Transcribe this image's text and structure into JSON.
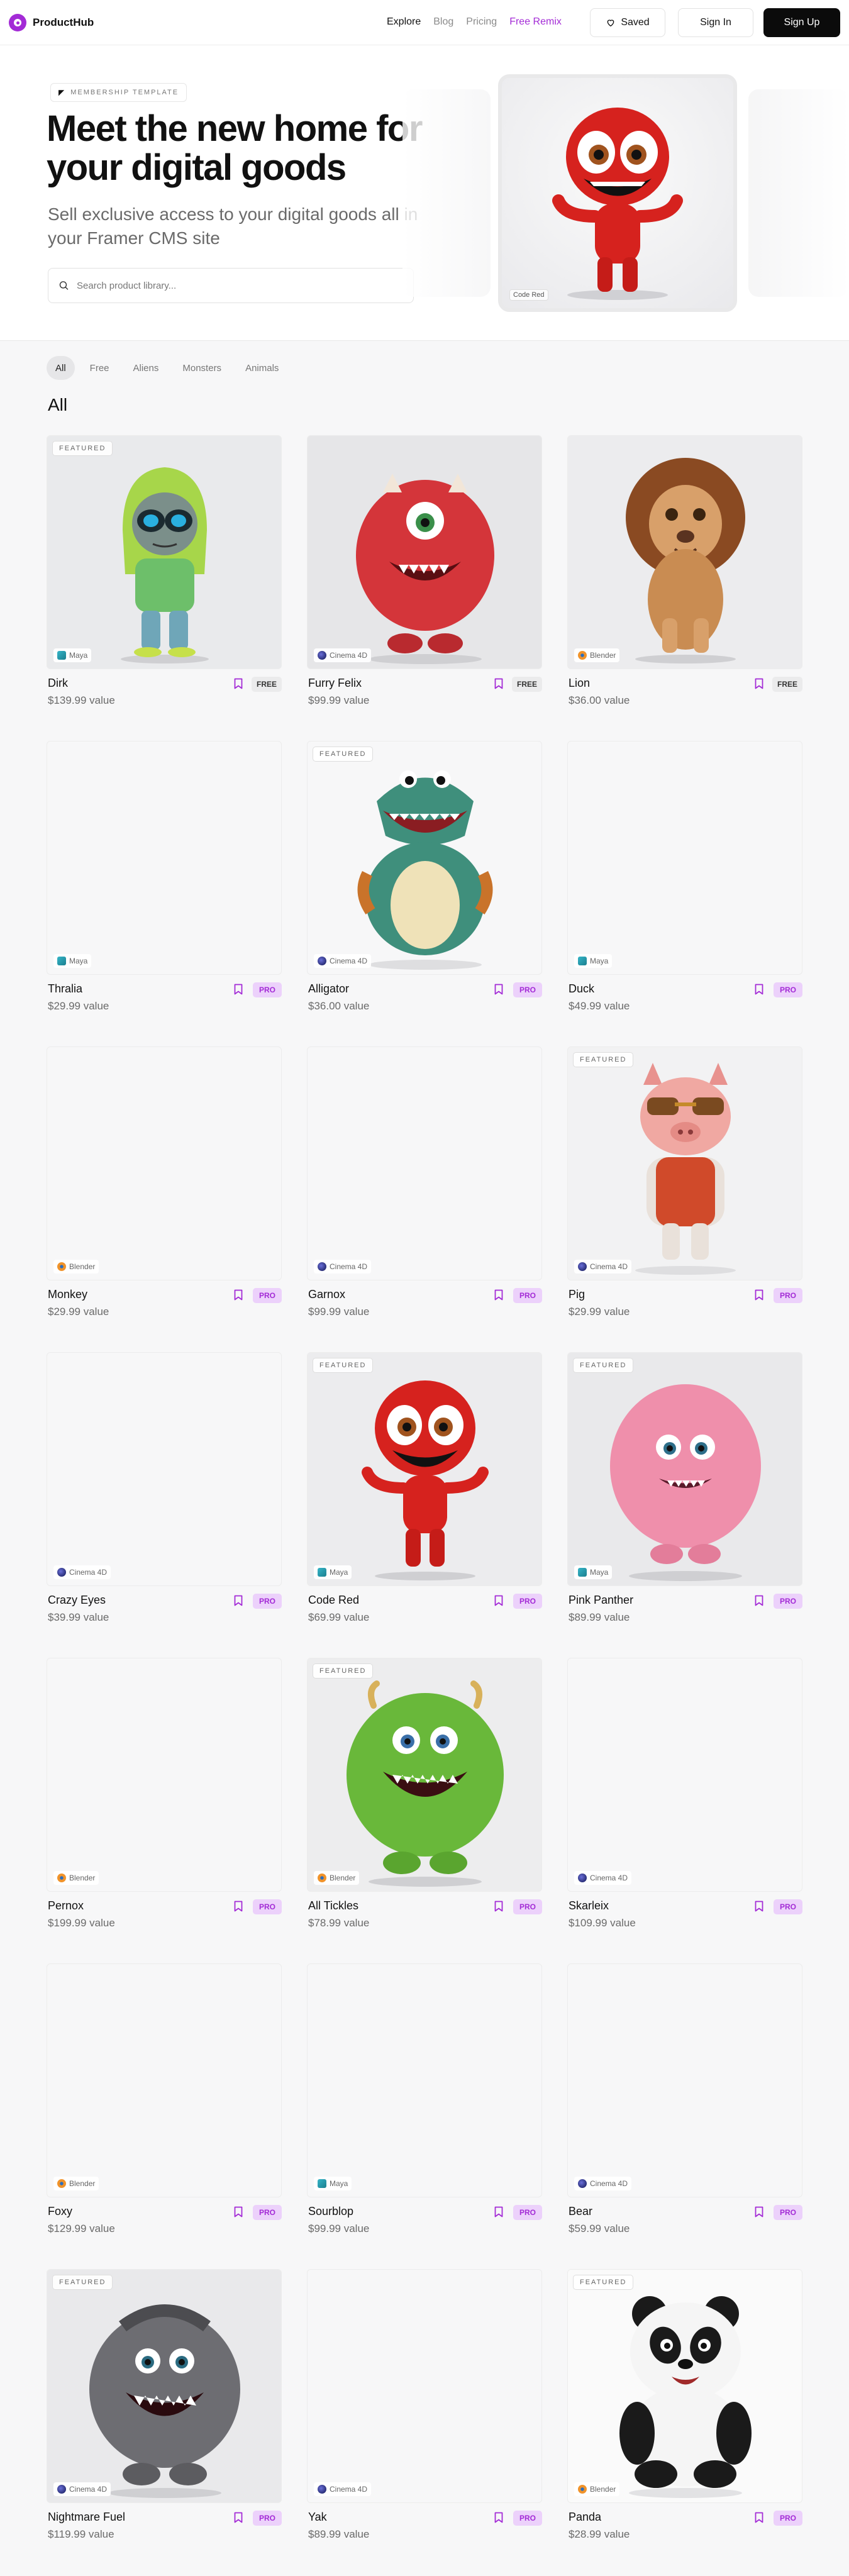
{
  "nav": {
    "brand": "ProductHub",
    "links": [
      "Explore",
      "Blog",
      "Pricing",
      "Free Remix"
    ],
    "saved_label": "Saved",
    "signin_label": "Sign In",
    "signup_label": "Sign Up"
  },
  "hero": {
    "tag": "MEMBERSHIP TEMPLATE",
    "title": "Meet the new home for your digital goods",
    "subtitle": "Sell exclusive access to your digital goods all in your Framer CMS site",
    "search_placeholder": "Search product library...",
    "card_label": "Code Red"
  },
  "filters": [
    "All",
    "Free",
    "Aliens",
    "Monsters",
    "Animals"
  ],
  "section_title": "All",
  "products": [
    {
      "name": "Dirk",
      "price": "$139.99 value",
      "tool": "Maya",
      "badge": "FREE",
      "featured": true,
      "image": "alien"
    },
    {
      "name": "Furry Felix",
      "price": "$99.99 value",
      "tool": "Cinema 4D",
      "badge": "FREE",
      "featured": false,
      "image": "red-monster"
    },
    {
      "name": "Lion",
      "price": "$36.00 value",
      "tool": "Blender",
      "badge": "FREE",
      "featured": false,
      "image": "lion"
    },
    {
      "name": "Thralia",
      "price": "$29.99 value",
      "tool": "Maya",
      "badge": "PRO",
      "featured": false,
      "image": "blank"
    },
    {
      "name": "Alligator",
      "price": "$36.00 value",
      "tool": "Cinema 4D",
      "badge": "PRO",
      "featured": true,
      "image": "alligator"
    },
    {
      "name": "Duck",
      "price": "$49.99 value",
      "tool": "Maya",
      "badge": "PRO",
      "featured": false,
      "image": "blank"
    },
    {
      "name": "Monkey",
      "price": "$29.99 value",
      "tool": "Blender",
      "badge": "PRO",
      "featured": false,
      "image": "blank"
    },
    {
      "name": "Garnox",
      "price": "$99.99 value",
      "tool": "Cinema 4D",
      "badge": "PRO",
      "featured": false,
      "image": "blank"
    },
    {
      "name": "Pig",
      "price": "$29.99 value",
      "tool": "Cinema 4D",
      "badge": "PRO",
      "featured": true,
      "image": "pig"
    },
    {
      "name": "Crazy Eyes",
      "price": "$39.99 value",
      "tool": "Cinema 4D",
      "badge": "PRO",
      "featured": false,
      "image": "blank"
    },
    {
      "name": "Code Red",
      "price": "$69.99 value",
      "tool": "Maya",
      "badge": "PRO",
      "featured": true,
      "image": "code-red"
    },
    {
      "name": "Pink Panther",
      "price": "$89.99 value",
      "tool": "Maya",
      "badge": "PRO",
      "featured": true,
      "image": "pink-monster"
    },
    {
      "name": "Pernox",
      "price": "$199.99 value",
      "tool": "Blender",
      "badge": "PRO",
      "featured": false,
      "image": "blank"
    },
    {
      "name": "All Tickles",
      "price": "$78.99 value",
      "tool": "Blender",
      "badge": "PRO",
      "featured": true,
      "image": "green-monster"
    },
    {
      "name": "Skarleix",
      "price": "$109.99 value",
      "tool": "Cinema 4D",
      "badge": "PRO",
      "featured": false,
      "image": "blank"
    },
    {
      "name": "Foxy",
      "price": "$129.99 value",
      "tool": "Blender",
      "badge": "PRO",
      "featured": false,
      "image": "blank"
    },
    {
      "name": "Sourblop",
      "price": "$99.99 value",
      "tool": "Maya",
      "badge": "PRO",
      "featured": false,
      "image": "blank"
    },
    {
      "name": "Bear",
      "price": "$59.99 value",
      "tool": "Cinema 4D",
      "badge": "PRO",
      "featured": false,
      "image": "blank"
    },
    {
      "name": "Nightmare Fuel",
      "price": "$119.99 value",
      "tool": "Cinema 4D",
      "badge": "PRO",
      "featured": true,
      "image": "grey-monster"
    },
    {
      "name": "Yak",
      "price": "$89.99 value",
      "tool": "Cinema 4D",
      "badge": "PRO",
      "featured": false,
      "image": "blank"
    },
    {
      "name": "Panda",
      "price": "$28.99 value",
      "tool": "Blender",
      "badge": "PRO",
      "featured": true,
      "image": "panda"
    }
  ],
  "featured_label": "FEATURED",
  "colors": {
    "accent": "#a32bd6",
    "pro_bg": "#ecd1fb",
    "free_bg": "#ebebec"
  }
}
